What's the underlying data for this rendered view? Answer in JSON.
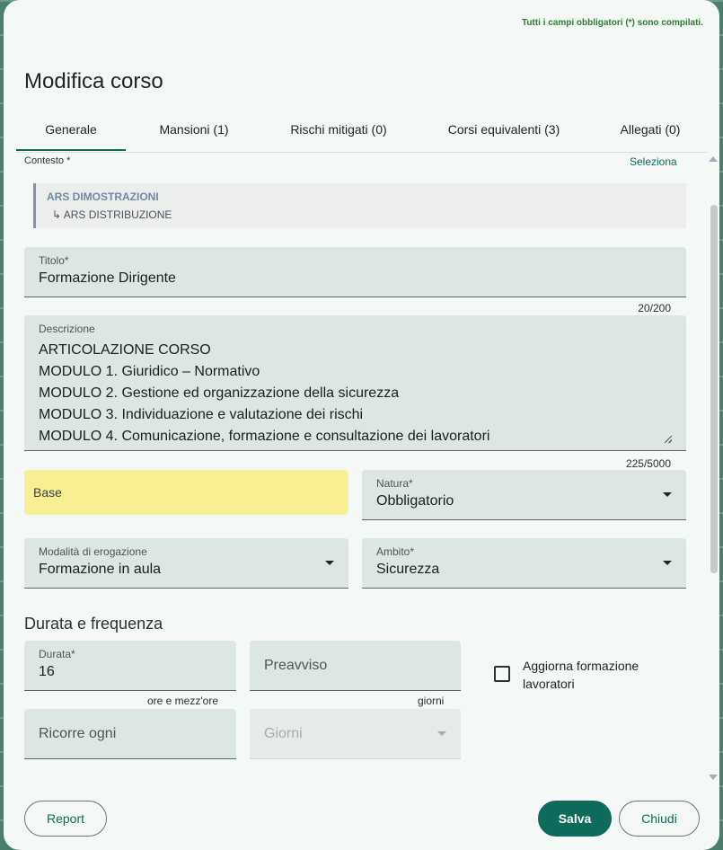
{
  "status_message": "Tutti i campi obbligatori (*) sono compilati.",
  "dialog_title": "Modifica corso",
  "tabs": [
    {
      "label": "Generale"
    },
    {
      "label": "Mansioni (1)"
    },
    {
      "label": "Rischi mitigati (0)"
    },
    {
      "label": "Corsi equivalenti (3)"
    },
    {
      "label": "Allegati (0)"
    }
  ],
  "context": {
    "label": "Contesto *",
    "select_link": "Seleziona",
    "main": "ARS DIMOSTRAZIONI",
    "sub": "↳ ARS DISTRIBUZIONE"
  },
  "titolo": {
    "label": "Titolo*",
    "value": "Formazione Dirigente",
    "counter": "20/200"
  },
  "descrizione": {
    "label": "Descrizione",
    "lines": [
      "ARTICOLAZIONE CORSO",
      "MODULO 1. Giuridico – Normativo",
      "MODULO 2. Gestione ed organizzazione della sicurezza",
      "MODULO 3. Individuazione e valutazione dei rischi",
      "MODULO 4. Comunicazione, formazione e consultazione dei lavoratori"
    ],
    "counter": "225/5000"
  },
  "base": {
    "label": "Base"
  },
  "natura": {
    "label": "Natura*",
    "value": "Obbligatorio"
  },
  "modalita": {
    "label": "Modalità di erogazione",
    "value": "Formazione in aula"
  },
  "ambito": {
    "label": "Ambito*",
    "value": "Sicurezza"
  },
  "durata_section": {
    "title": "Durata e frequenza"
  },
  "durata": {
    "label": "Durata*",
    "value": "16",
    "hint": "ore e mezz'ore"
  },
  "preavviso": {
    "placeholder": "Preavviso",
    "hint": "giorni"
  },
  "aggiorna": {
    "label": "Aggiorna formazione lavoratori",
    "checked": false
  },
  "ricorre": {
    "placeholder": "Ricorre ogni"
  },
  "giorni": {
    "placeholder": "Giorni"
  },
  "buttons": {
    "report": "Report",
    "salva": "Salva",
    "chiudi": "Chiudi"
  },
  "colors": {
    "accent": "#0e6b5c",
    "status_ok": "#2e7d32",
    "base_highlight": "#f7ef92"
  }
}
